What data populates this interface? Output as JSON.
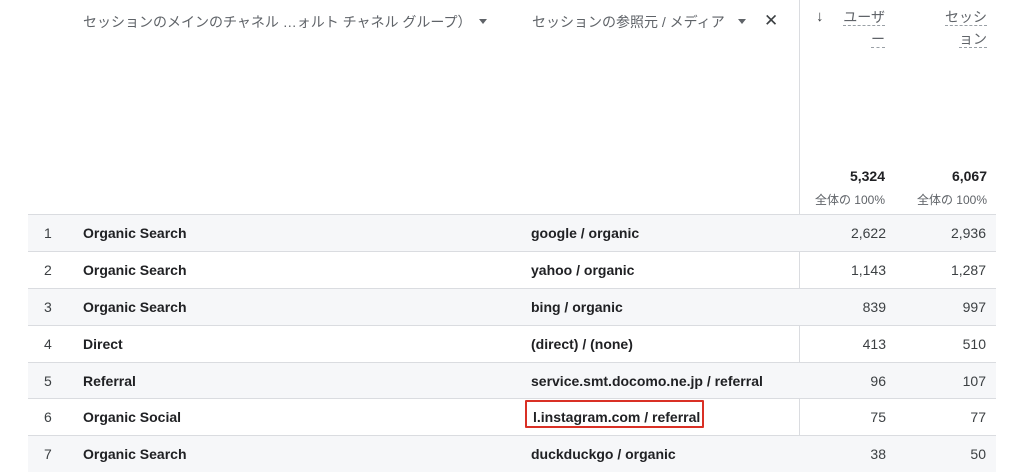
{
  "header": {
    "dimension1": "セッションのメインのチャネル …ォルト チャネル グループ）",
    "dimension2": "セッションの参照元 / メディア",
    "close_symbol": "✕",
    "sort_arrow": "↓",
    "metric1": [
      "ユーザ",
      "ー"
    ],
    "metric2": [
      "セッシ",
      "ョン"
    ]
  },
  "totals": {
    "users": "5,324",
    "sessions": "6,067",
    "users_pct": "全体の 100%",
    "sessions_pct": "全体の 100%"
  },
  "rows": [
    {
      "idx": "1",
      "channel": "Organic Search",
      "source": "google / organic",
      "users": "2,622",
      "sessions": "2,936"
    },
    {
      "idx": "2",
      "channel": "Organic Search",
      "source": "yahoo / organic",
      "users": "1,143",
      "sessions": "1,287"
    },
    {
      "idx": "3",
      "channel": "Organic Search",
      "source": "bing / organic",
      "users": "839",
      "sessions": "997"
    },
    {
      "idx": "4",
      "channel": "Direct",
      "source": "(direct) / (none)",
      "users": "413",
      "sessions": "510"
    },
    {
      "idx": "5",
      "channel": "Referral",
      "source": "service.smt.docomo.ne.jp / referral",
      "users": "96",
      "sessions": "107"
    },
    {
      "idx": "6",
      "channel": "Organic Social",
      "source": "l.instagram.com / referral",
      "users": "75",
      "sessions": "77"
    },
    {
      "idx": "7",
      "channel": "Organic Search",
      "source": "duckduckgo / organic",
      "users": "38",
      "sessions": "50"
    }
  ],
  "highlight_color": "#d93025",
  "icons": {
    "sort": "arrow-down-icon",
    "dropdown": "caret-down-icon",
    "remove": "close-icon"
  }
}
